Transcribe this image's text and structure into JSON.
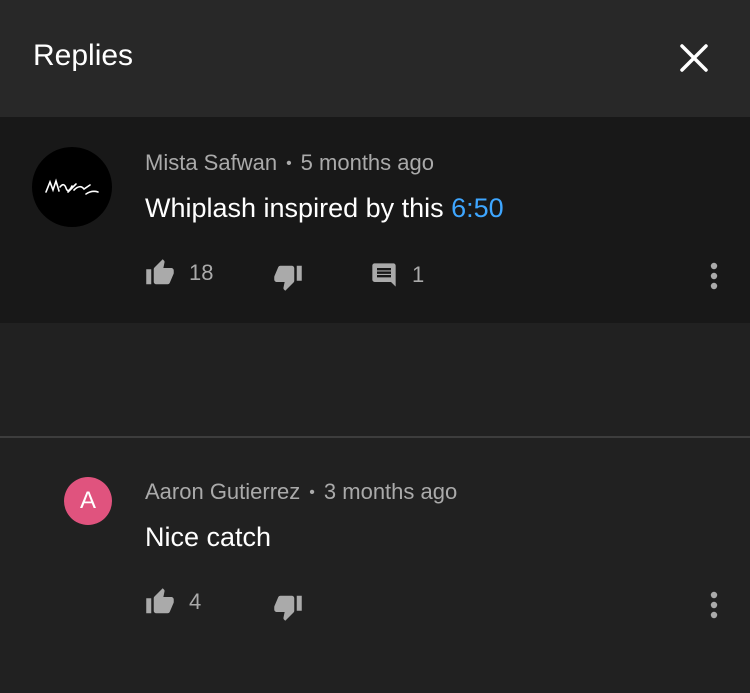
{
  "header": {
    "title": "Replies"
  },
  "main_comment": {
    "author": "Mista Safwan",
    "time": "5 months ago",
    "text": "Whiplash inspired by this ",
    "timestamp_link": "6:50",
    "likes": "18",
    "replies": "1"
  },
  "reply": {
    "avatar_letter": "A",
    "author": "Aaron Gutierrez",
    "time": "3 months ago",
    "text": "Nice catch",
    "likes": "4"
  },
  "colors": {
    "avatar_reply": "#e0537e",
    "link": "#3ea6ff"
  }
}
